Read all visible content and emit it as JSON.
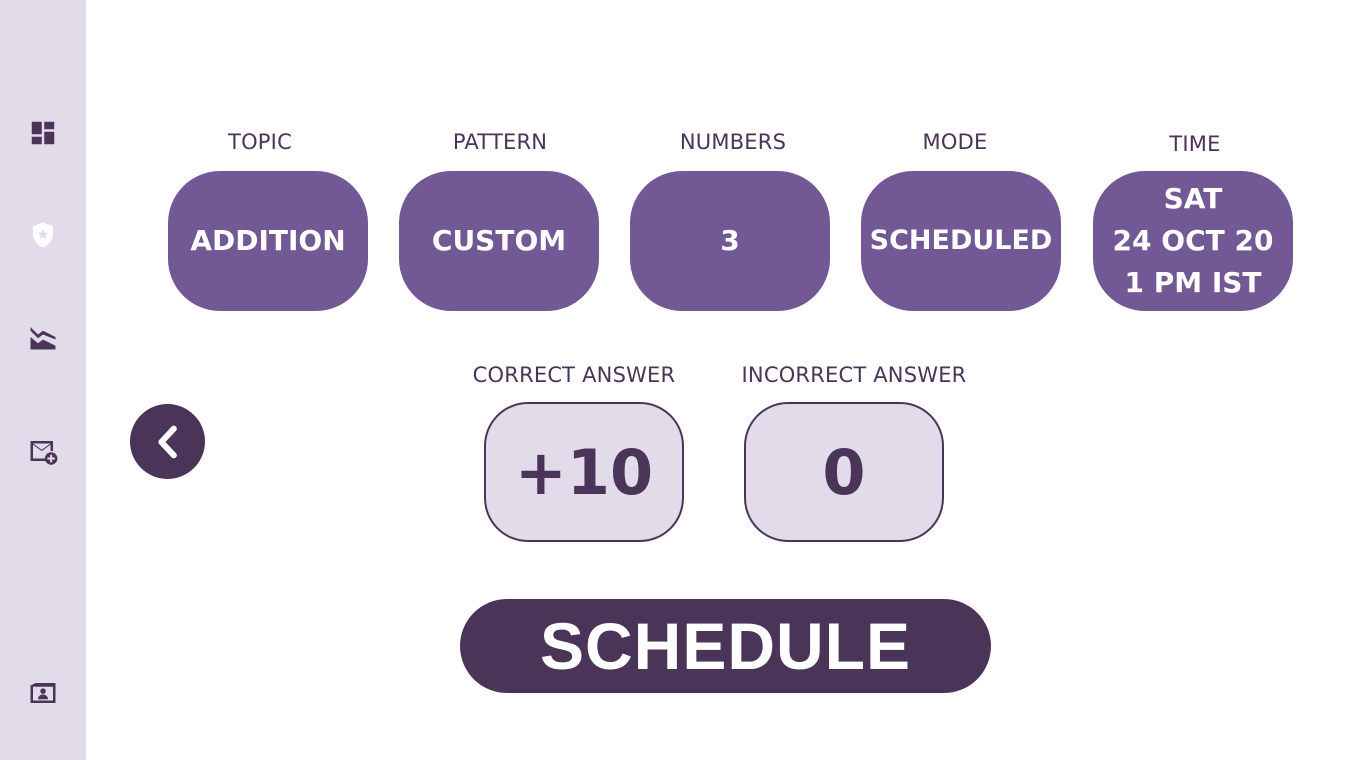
{
  "sidebar": {
    "icons": [
      "dashboard-icon",
      "shield-star-icon",
      "chart-area-icon",
      "mail-add-icon",
      "contacts-folder-icon"
    ]
  },
  "fields": {
    "topic": {
      "label": "TOPIC",
      "value": "ADDITION"
    },
    "pattern": {
      "label": "PATTERN",
      "value": "CUSTOM"
    },
    "numbers": {
      "label": "NUMBERS",
      "value": "3"
    },
    "mode": {
      "label": "MODE",
      "value": "SCHEDULED"
    },
    "time": {
      "label": "TIME",
      "line1": "SAT",
      "line2": "24 OCT 20",
      "line3": "1 PM IST"
    }
  },
  "scoring": {
    "correct": {
      "label": "CORRECT ANSWER",
      "value": "+10"
    },
    "incorrect": {
      "label": "INCORRECT ANSWER",
      "value": "0"
    }
  },
  "actions": {
    "schedule_label": "SCHEDULE",
    "back_icon": "chevron-left-icon"
  },
  "colors": {
    "sidebar_bg": "#e2dcea",
    "pill_bg": "#725895",
    "dark": "#4a3558",
    "answer_bg": "#e2dcea"
  }
}
